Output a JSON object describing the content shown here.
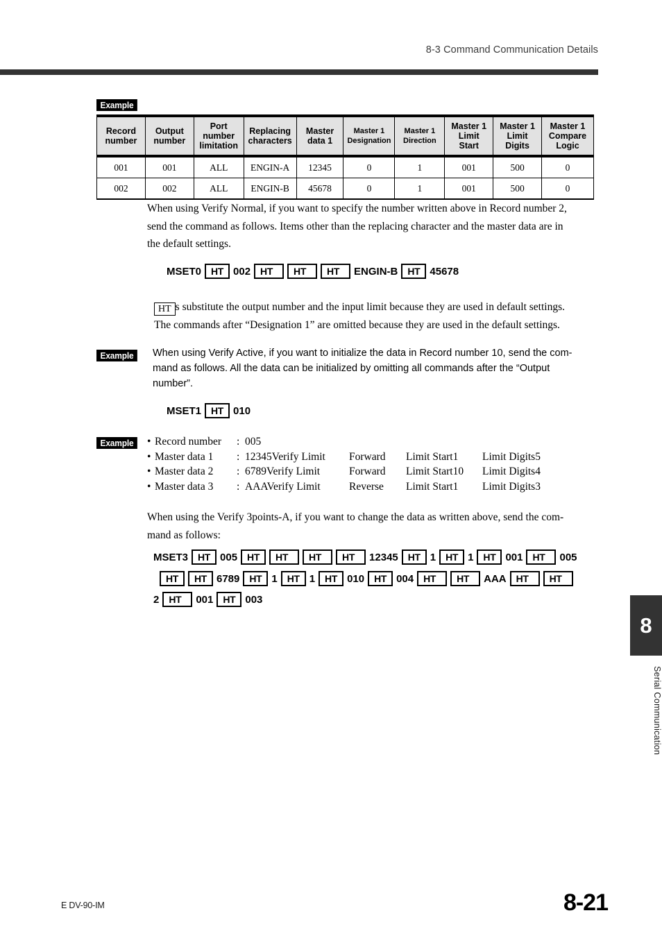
{
  "header": {
    "section_title": "8-3 Command Communication Details"
  },
  "example_label": "Example",
  "table": {
    "headers": [
      "Record number",
      "Output number",
      "Port number limitation",
      "Replacing characters",
      "Master data 1",
      "Master 1 Designation",
      "Master 1 Direction",
      "Master 1 Limit Start",
      "Master 1 Limit Digits",
      "Master 1 Compare Logic"
    ],
    "headers_lines": [
      [
        "Record",
        "number"
      ],
      [
        "Output",
        "number"
      ],
      [
        "Port",
        "number",
        "limitation"
      ],
      [
        "Replacing",
        "characters"
      ],
      [
        "Master",
        "data 1"
      ],
      [
        "Master 1",
        "Designation"
      ],
      [
        "Master 1",
        "Direction"
      ],
      [
        "Master 1",
        "Limit",
        "Start"
      ],
      [
        "Master 1",
        "Limit",
        "Digits"
      ],
      [
        "Master 1",
        "Compare",
        "Logic"
      ]
    ],
    "rows": [
      [
        "001",
        "001",
        "ALL",
        "ENGIN-A",
        "12345",
        "0",
        "1",
        "001",
        "500",
        "0"
      ],
      [
        "002",
        "002",
        "ALL",
        "ENGIN-B",
        "45678",
        "0",
        "1",
        "001",
        "500",
        "0"
      ]
    ]
  },
  "para1": {
    "line1": "When using Verify Normal, if you want to specify the number written above in Record number 2,",
    "line2": "send the command as follows. Items other than the replacing character and the master data are in",
    "line3": "the default settings."
  },
  "cmd0": {
    "tokens": [
      "MSET0",
      "HT",
      "002",
      "HT",
      "HT",
      "HT",
      "ENGIN-B",
      "HT",
      "45678"
    ]
  },
  "para2": {
    "ht_label": "HT",
    "line1_after": "s substitute the output number and the input limit because they are used in default settings.",
    "line2": "The commands after “Designation 1” are omitted because they are used in the default settings."
  },
  "para3": {
    "line1": "When using Verify Active, if you want to initialize the data in Record number 10, send the com-",
    "line2": "mand as follows. All the data can be initialized by omitting all commands after the “Output",
    "line3": "number”."
  },
  "cmd1": {
    "tokens": [
      "MSET1",
      "HT",
      "010"
    ]
  },
  "spec_list": {
    "rows": [
      {
        "label": "Record number",
        "colon": ":",
        "c1": "005",
        "c2": "",
        "c3": "",
        "c4": ""
      },
      {
        "label": "Master data 1",
        "colon": ":",
        "c1": "12345Verify Limit",
        "c2": "Forward",
        "c3": "Limit Start1",
        "c4": "Limit Digits5"
      },
      {
        "label": "Master data 2",
        "colon": ":",
        "c1": "6789Verify Limit",
        "c2": "Forward",
        "c3": "Limit Start10",
        "c4": "Limit Digits4"
      },
      {
        "label": "Master data 3",
        "colon": ":",
        "c1": "AAAVerify Limit",
        "c2": "Reverse",
        "c3": "Limit Start1",
        "c4": "Limit Digits3"
      }
    ],
    "bullet": "•"
  },
  "para4": {
    "line1": "When using the Verify 3points-A, if you want to change the data as written above, send the com-",
    "line2": "mand as follows:"
  },
  "cmd3": {
    "line1": [
      "MSET3",
      "HT",
      "005",
      "HT",
      "HT",
      "HT",
      "HT",
      "12345",
      "HT",
      "1",
      "HT",
      "1",
      "HT",
      "001",
      "HT",
      "005"
    ],
    "line2": [
      "HT",
      "HT",
      "6789",
      "HT",
      "1",
      "HT",
      "1",
      "HT",
      "010",
      "HT",
      "004",
      "HT",
      "HT",
      "AAA",
      "HT",
      "HT"
    ],
    "line3": [
      "2",
      "HT",
      "001",
      "HT",
      "003"
    ]
  },
  "chapter_tab": {
    "number": "8",
    "vertical_title": "Serial Communication"
  },
  "footer": {
    "doc_code": "E DV-90-IM",
    "page_number": "8-21"
  },
  "colors": {
    "rule": "#333333",
    "table_header_bg": "#e2e2e2",
    "badge_bg": "#000000",
    "tab_bg": "#333333"
  }
}
